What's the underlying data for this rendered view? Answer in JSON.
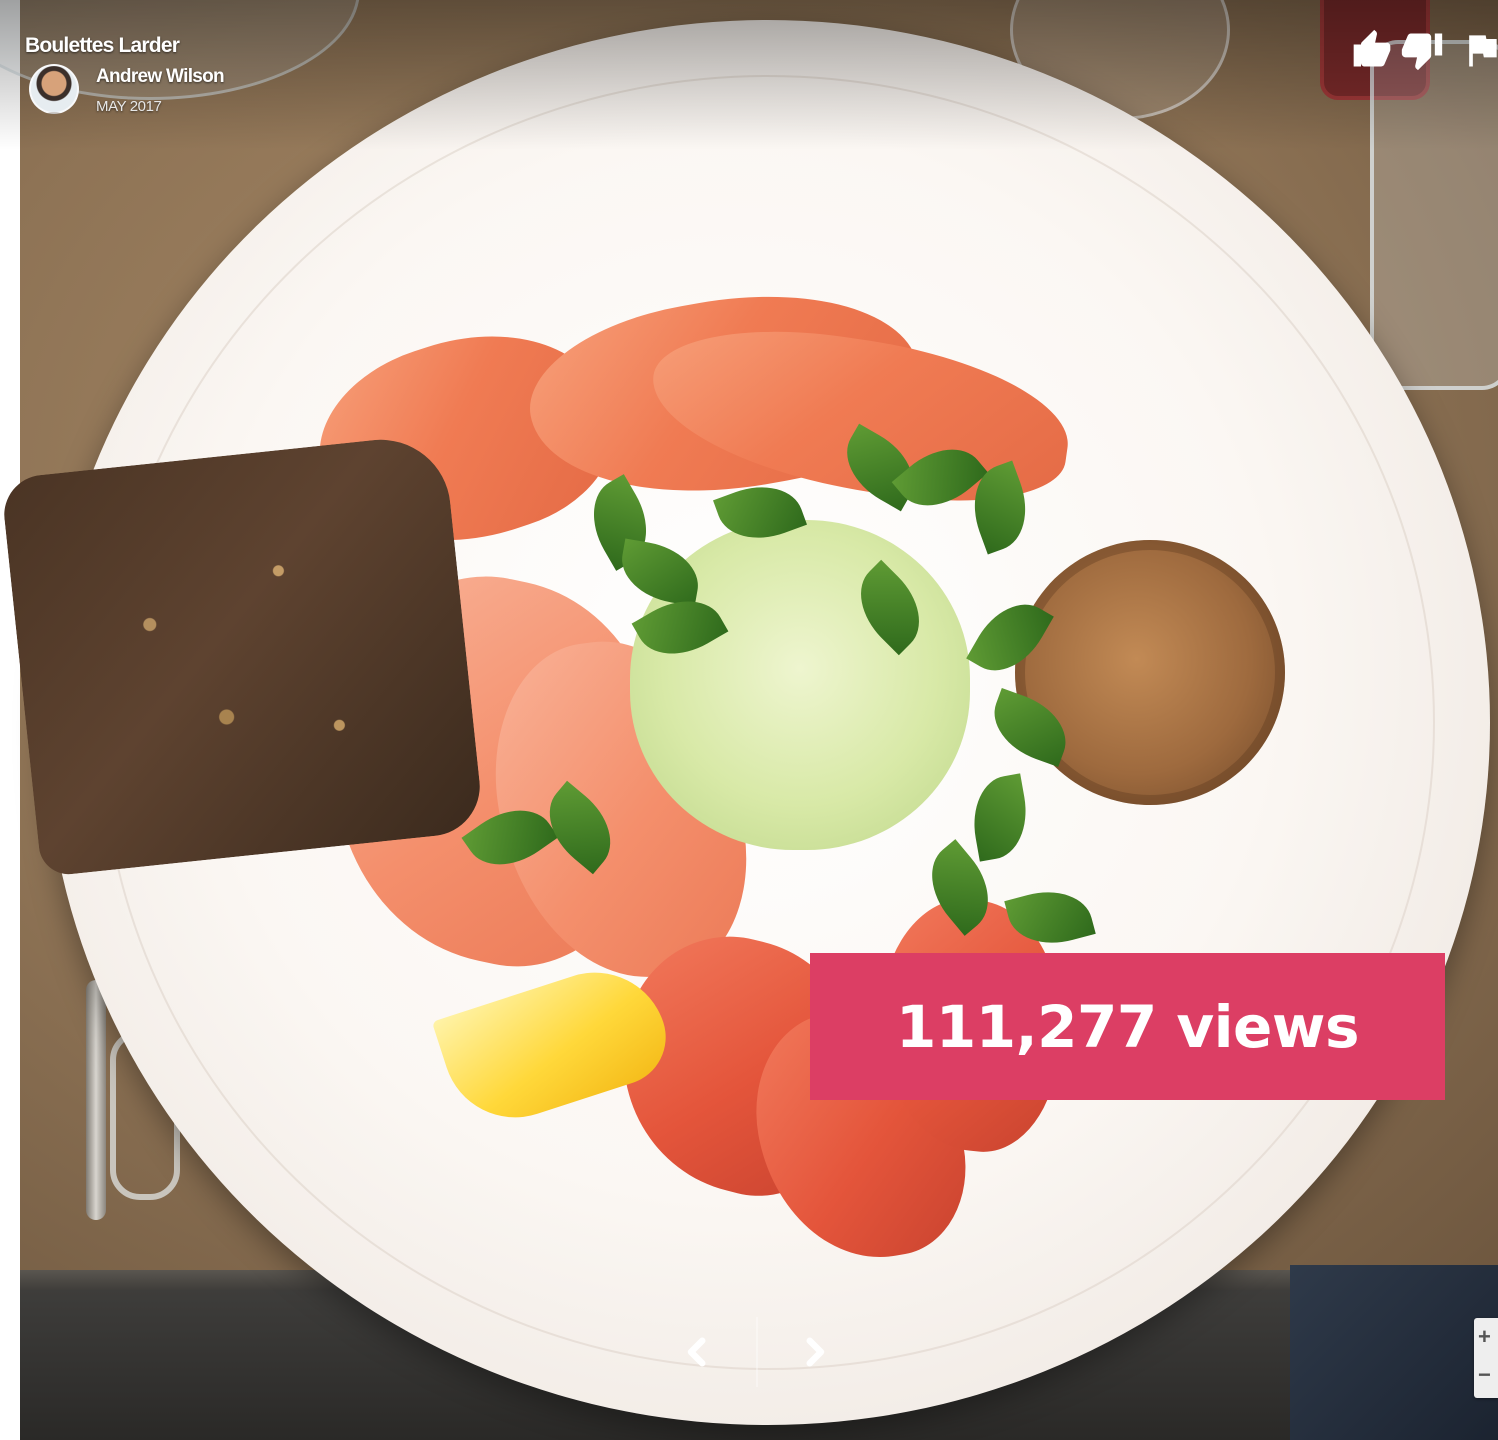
{
  "header": {
    "place_name": "Boulettes Larder",
    "author_name": "Andrew Wilson",
    "date": "MAY 2017"
  },
  "actions": {
    "like_icon": "thumbs-up-icon",
    "dislike_icon": "thumbs-down-icon",
    "flag_icon": "flag-icon"
  },
  "badge": {
    "views": "111,277 views",
    "color": "#dc3e64"
  },
  "navigation": {
    "prev_icon": "chevron-left-icon",
    "next_icon": "chevron-right-icon"
  },
  "zoom": {
    "in_label": "+",
    "out_label": "−"
  }
}
